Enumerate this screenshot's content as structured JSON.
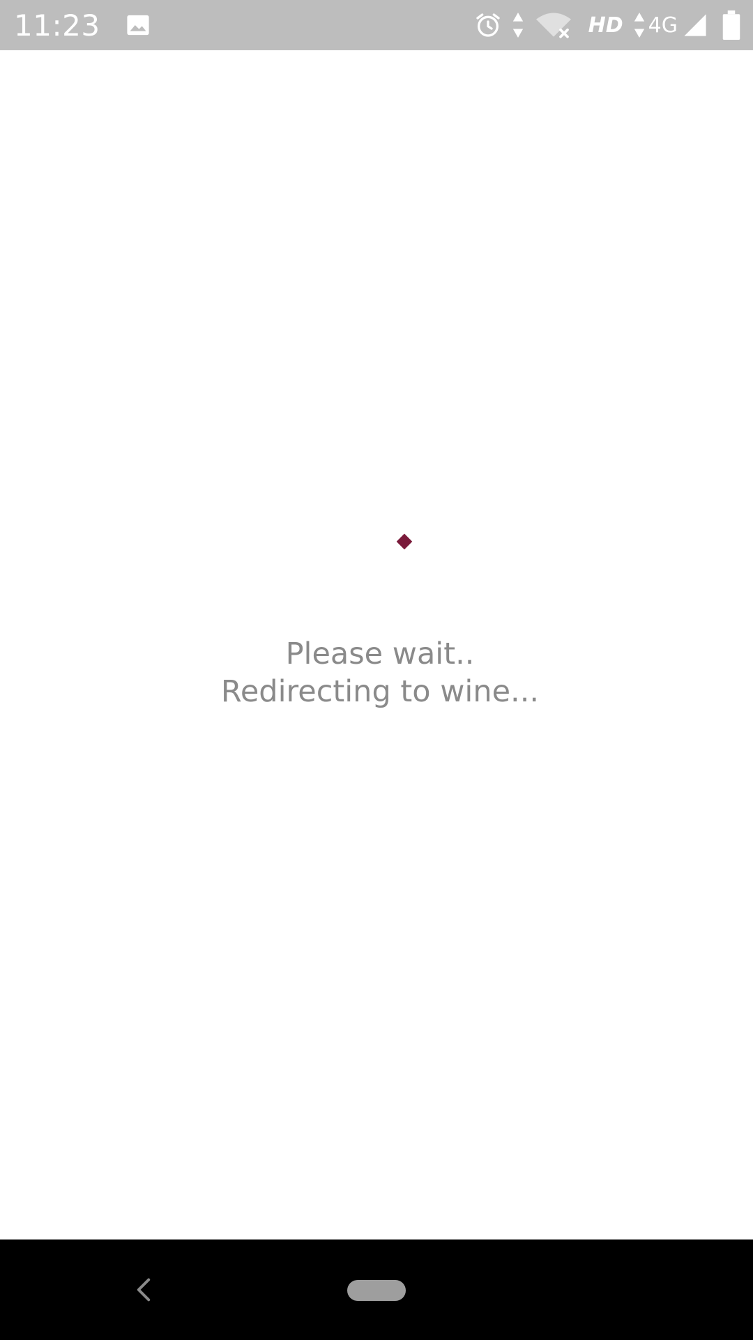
{
  "status_bar": {
    "time": "11:23",
    "network_quality": "HD",
    "network_type": "4G",
    "icons": [
      "image-icon",
      "alarm-icon",
      "data-arrows-icon",
      "wifi-off-icon",
      "signal-icon",
      "battery-icon"
    ]
  },
  "loading": {
    "line1": "Please wait..",
    "line2": "Redirecting to wine...",
    "spinner_color": "#7a1a3a"
  },
  "nav_bar": {
    "icons": [
      "back-icon",
      "home-pill-icon"
    ]
  },
  "colors": {
    "status_bar_bg": "#bdbdbd",
    "text_gray": "#8a8a8a",
    "accent": "#7a1a3a",
    "nav_bg": "#000000"
  }
}
